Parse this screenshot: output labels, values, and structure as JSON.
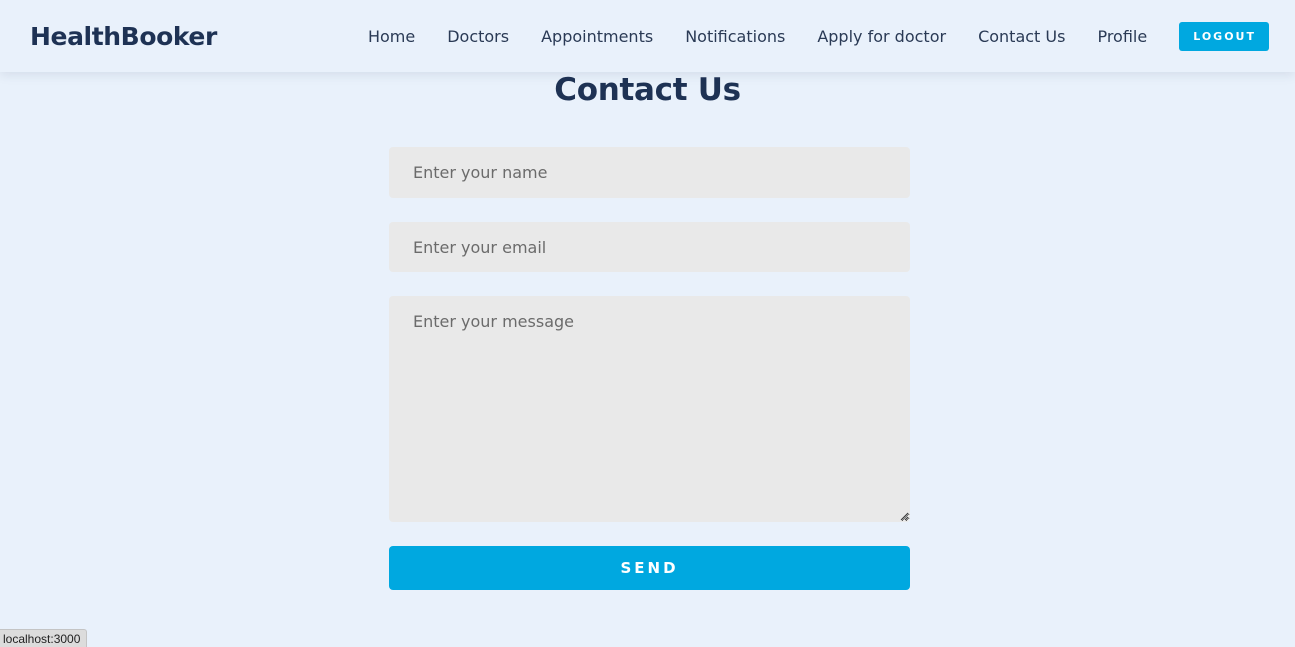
{
  "navbar": {
    "brand": "HealthBooker",
    "links": [
      "Home",
      "Doctors",
      "Appointments",
      "Notifications",
      "Apply for doctor",
      "Contact Us",
      "Profile"
    ],
    "logout_label": "LOGOUT"
  },
  "contact": {
    "title": "Contact Us",
    "name_placeholder": "Enter your name",
    "email_placeholder": "Enter your email",
    "message_placeholder": "Enter your message",
    "send_label": "SEND"
  },
  "status_bar": {
    "url": "localhost:3000"
  },
  "colors": {
    "accent": "#00a8e0",
    "background": "#e9f1fb",
    "heading": "#1e3254",
    "field": "#e9e9e9"
  }
}
